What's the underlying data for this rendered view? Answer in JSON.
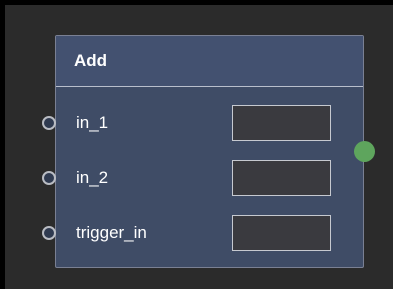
{
  "node": {
    "title": "Add",
    "inputs": [
      {
        "label": "in_1",
        "value": ""
      },
      {
        "label": "in_2",
        "value": ""
      },
      {
        "label": "trigger_in",
        "value": ""
      }
    ],
    "output": {
      "status_color": "#5ea55d"
    }
  },
  "colors": {
    "canvas": "#2b2b2b",
    "node_body": "#3f4c66",
    "node_header": "#435170",
    "port_field": "#3a3a3f",
    "text": "#ffffff"
  }
}
